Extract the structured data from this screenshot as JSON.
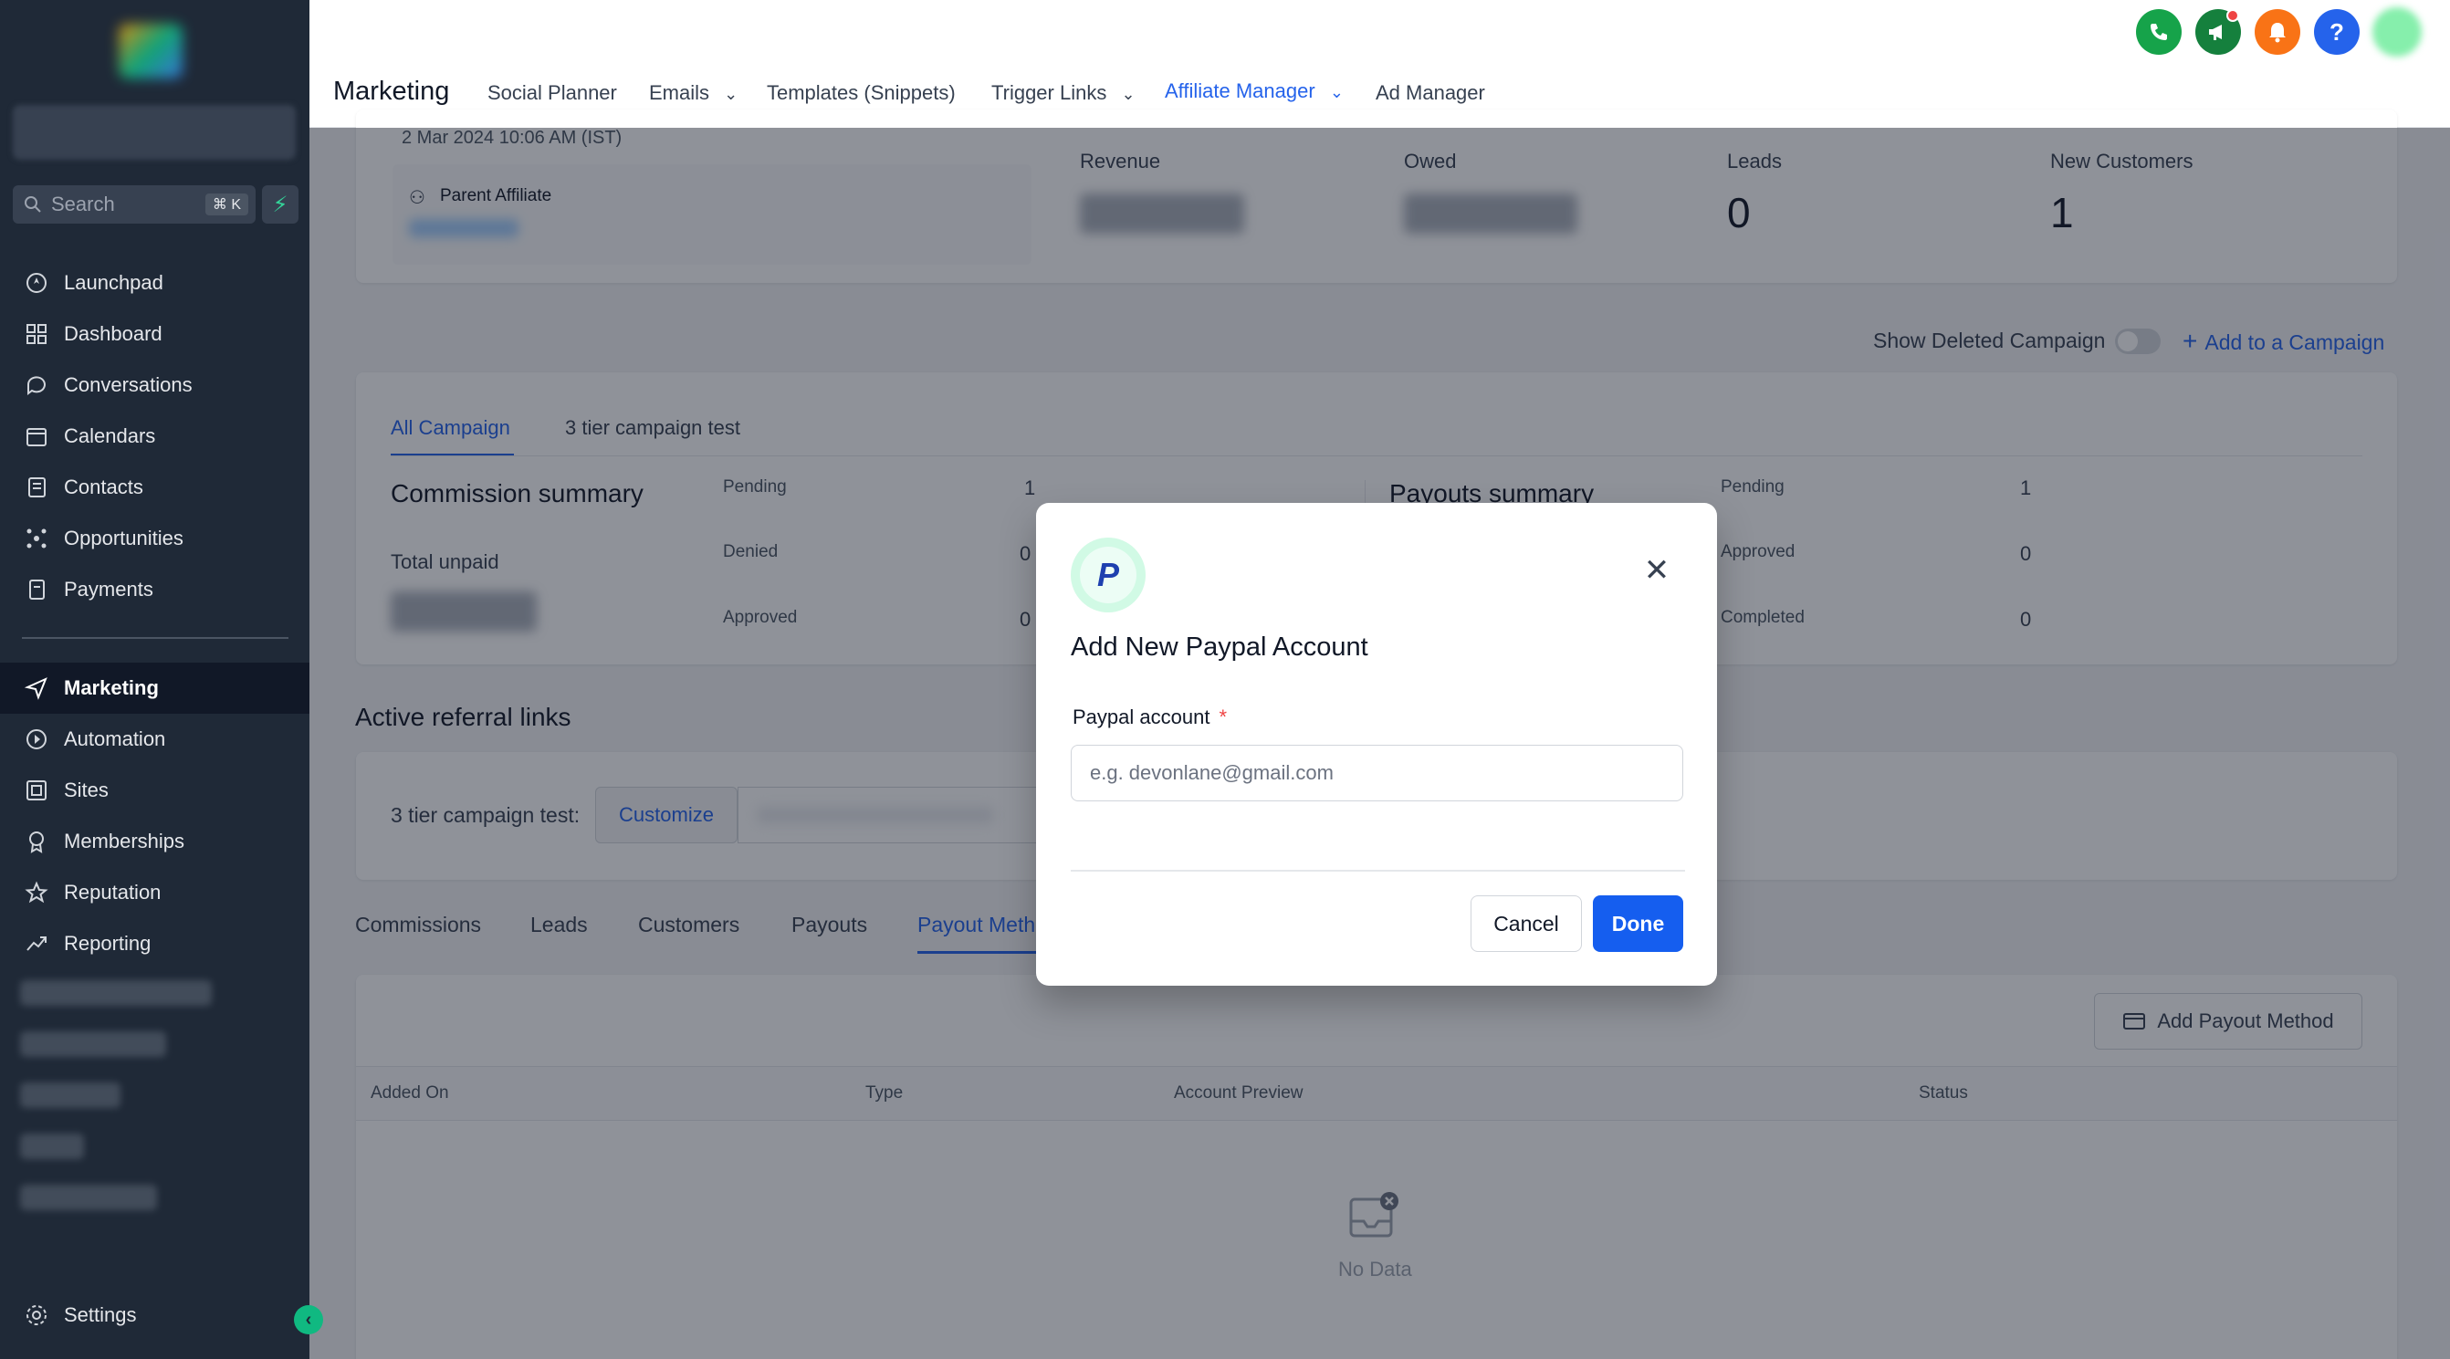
{
  "sidebar": {
    "search_placeholder": "Search",
    "search_shortcut": "⌘ K",
    "items": [
      {
        "label": "Launchpad",
        "icon": "rocket-icon"
      },
      {
        "label": "Dashboard",
        "icon": "grid-icon"
      },
      {
        "label": "Conversations",
        "icon": "chat-icon"
      },
      {
        "label": "Calendars",
        "icon": "calendar-icon"
      },
      {
        "label": "Contacts",
        "icon": "contacts-icon"
      },
      {
        "label": "Opportunities",
        "icon": "pipeline-icon"
      },
      {
        "label": "Payments",
        "icon": "receipt-icon"
      }
    ],
    "items2": [
      {
        "label": "Marketing",
        "icon": "send-icon",
        "active": true
      },
      {
        "label": "Automation",
        "icon": "automation-icon"
      },
      {
        "label": "Sites",
        "icon": "sites-icon"
      },
      {
        "label": "Memberships",
        "icon": "membership-icon"
      },
      {
        "label": "Reputation",
        "icon": "star-icon"
      },
      {
        "label": "Reporting",
        "icon": "chart-icon"
      }
    ],
    "settings_label": "Settings"
  },
  "header": {
    "title": "Marketing",
    "tabs": [
      {
        "label": "Social Planner"
      },
      {
        "label": "Emails"
      },
      {
        "label": "Templates (Snippets)"
      },
      {
        "label": "Trigger Links"
      },
      {
        "label": "Affiliate Manager",
        "active": true
      },
      {
        "label": "Ad Manager"
      }
    ],
    "help_glyph": "?"
  },
  "affiliate": {
    "date_text": "2 Mar 2024 10:06 AM (IST)",
    "parent_affiliate_label": "Parent Affiliate",
    "stats": [
      {
        "label": "Revenue"
      },
      {
        "label": "Owed"
      },
      {
        "label": "Leads",
        "value": "0"
      },
      {
        "label": "New Customers",
        "value": "1"
      }
    ],
    "show_deleted_label": "Show Deleted Campaign",
    "add_campaign_label": "Add to a Campaign"
  },
  "campaign": {
    "tabs": [
      {
        "label": "All Campaign",
        "active": true
      },
      {
        "label": "3 tier campaign test"
      }
    ],
    "commission_title": "Commission summary",
    "total_unpaid_label": "Total unpaid",
    "commission_rows": [
      {
        "label": "Pending",
        "value": "1"
      },
      {
        "label": "Denied",
        "value": "0"
      },
      {
        "label": "Approved",
        "value": "0"
      }
    ],
    "payouts_title": "Payouts summary",
    "payout_rows": [
      {
        "label": "Pending",
        "value": "1"
      },
      {
        "label": "Approved",
        "value": "0"
      },
      {
        "label": "Completed",
        "value": "0"
      }
    ]
  },
  "referral": {
    "title": "Active referral links",
    "campaign_label": "3 tier campaign test:",
    "customize_label": "Customize"
  },
  "bottom_tabs": [
    {
      "label": "Commissions"
    },
    {
      "label": "Leads"
    },
    {
      "label": "Customers"
    },
    {
      "label": "Payouts"
    },
    {
      "label": "Payout Meth",
      "active": true
    }
  ],
  "payout_table": {
    "add_button_label": "Add Payout Method",
    "columns": [
      "Added On",
      "Type",
      "Account Preview",
      "Status"
    ],
    "empty_text": "No Data"
  },
  "modal": {
    "title": "Add New Paypal Account",
    "field_label": "Paypal account",
    "required_marker": "*",
    "placeholder": "e.g. devonlane@gmail.com",
    "cancel_label": "Cancel",
    "done_label": "Done",
    "logo_glyph": "P",
    "close_glyph": "✕"
  },
  "colors": {
    "accent": "#2563eb",
    "primary_button": "#155eef",
    "sidebar_bg": "#1f2937"
  }
}
